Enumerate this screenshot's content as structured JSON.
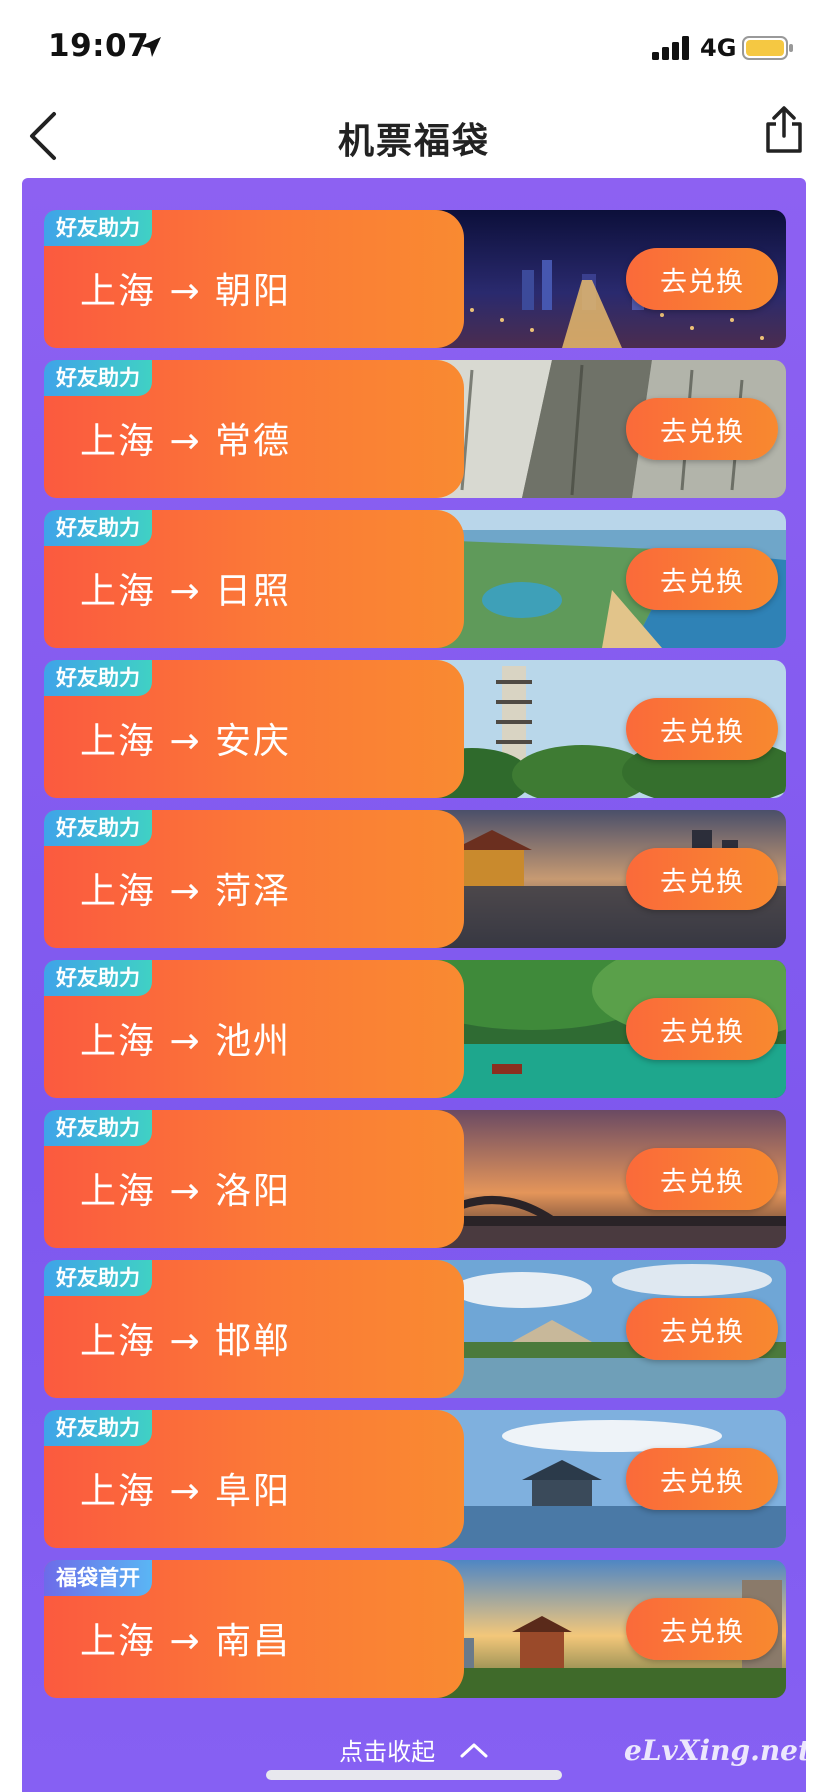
{
  "status_bar": {
    "time": "19:07",
    "network": "4G",
    "battery_color": "#f5c842"
  },
  "nav": {
    "title": "机票福袋"
  },
  "colors": {
    "list_background": "#8059ef",
    "ticket_orange": "#fb6a3a",
    "tag_assist": "#40bfd8",
    "tag_first": "#6d6be9"
  },
  "tickets": [
    {
      "tag": "好友助力",
      "route": "上海 → 朝阳",
      "button": "去兑换",
      "photo": "night-city-skyline"
    },
    {
      "tag": "好友助力",
      "route": "上海 → 常德",
      "button": "去兑换",
      "photo": "rock-cliff-formation"
    },
    {
      "tag": "好友助力",
      "route": "上海 → 日照",
      "button": "去兑换",
      "photo": "coastal-aerial-view"
    },
    {
      "tag": "好友助力",
      "route": "上海 → 安庆",
      "button": "去兑换",
      "photo": "pagoda-tower"
    },
    {
      "tag": "好友助力",
      "route": "上海 → 菏泽",
      "button": "去兑换",
      "photo": "pavilion-at-dusk"
    },
    {
      "tag": "好友助力",
      "route": "上海 → 池州",
      "button": "去兑换",
      "photo": "green-lake-with-boat"
    },
    {
      "tag": "好友助力",
      "route": "上海 → 洛阳",
      "button": "去兑换",
      "photo": "arch-bridge-sunset"
    },
    {
      "tag": "好友助力",
      "route": "上海 → 邯郸",
      "button": "去兑换",
      "photo": "lakeside-ancient-wall"
    },
    {
      "tag": "好友助力",
      "route": "上海 → 阜阳",
      "button": "去兑换",
      "photo": "temple-on-water"
    },
    {
      "tag": "福袋首开",
      "route": "上海 → 南昌",
      "button": "去兑换",
      "photo": "tower-pavilion-city"
    }
  ],
  "footer": {
    "collapse_label": "点击收起",
    "watermark": "eLvXing.net"
  }
}
